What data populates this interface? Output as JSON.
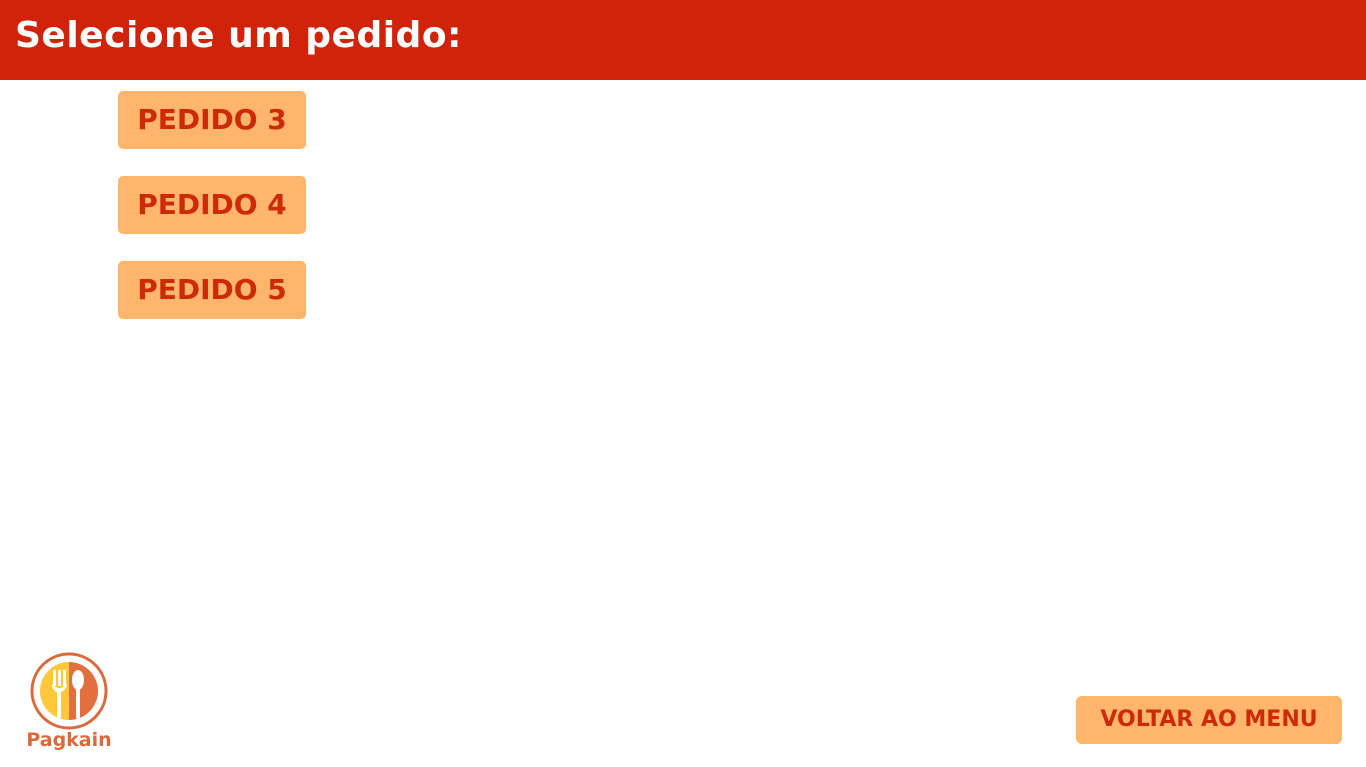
{
  "header": {
    "title": "Selecione um pedido:"
  },
  "orders": [
    {
      "label": "PEDIDO 3"
    },
    {
      "label": "PEDIDO 4"
    },
    {
      "label": "PEDIDO 5"
    }
  ],
  "footer": {
    "back_label": "VOLTAR AO MENU",
    "logo_text": "Pagkain",
    "logo_icon": "fork-spoon-plate-icon"
  },
  "colors": {
    "header_bg": "#d12309",
    "button_bg": "#ffb56b",
    "button_text": "#cc2a08",
    "logo_ring": "#d86a3c",
    "logo_yellow": "#ffc83a",
    "logo_orange": "#e2703e"
  }
}
